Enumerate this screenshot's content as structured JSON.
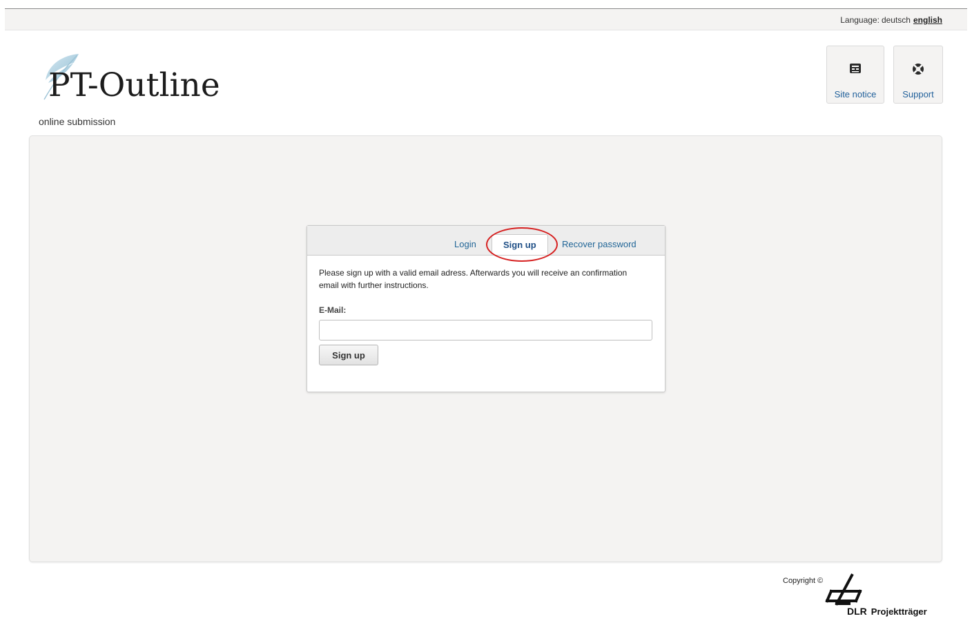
{
  "language": {
    "prefix": "Language:",
    "deutsch": "deutsch",
    "english": "english"
  },
  "brand": {
    "name": "PT-Outline",
    "tagline": "online submission"
  },
  "header_buttons": {
    "site_notice": {
      "label": "Site notice",
      "icon": "building-icon"
    },
    "support": {
      "label": "Support",
      "icon": "lifebuoy-icon"
    }
  },
  "auth": {
    "tabs": [
      {
        "label": "Login"
      },
      {
        "label": "Sign up",
        "active": true
      },
      {
        "label": "Recover password"
      }
    ],
    "intro": "Please sign up with a valid email adress. Afterwards you will receive an confirmation email with further instructions.",
    "email_label": "E-Mail:",
    "email_value": "",
    "submit_label": "Sign up"
  },
  "footer": {
    "copyright": "Copyright ©",
    "org_short": "DLR",
    "org_suffix": "Projektträger"
  },
  "colors": {
    "link": "#1f6496",
    "panel_bg": "#f4f3f2",
    "highlight": "#d61f1f"
  }
}
